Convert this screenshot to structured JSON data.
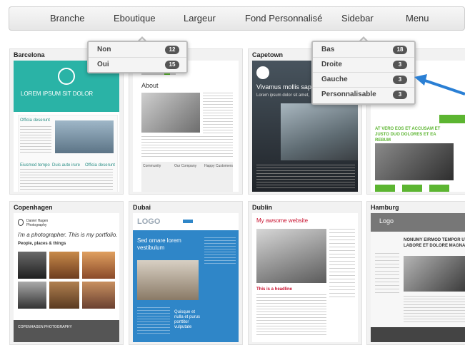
{
  "nav": {
    "items": [
      "Branche",
      "Eboutique",
      "Largeur",
      "Fond Personnalisé",
      "Sidebar",
      "Menu"
    ]
  },
  "dropdown_largeur": {
    "options": [
      {
        "label": "Non",
        "count": "12"
      },
      {
        "label": "Oui",
        "count": "15"
      }
    ]
  },
  "dropdown_sidebar": {
    "options": [
      {
        "label": "Bas",
        "count": "18"
      },
      {
        "label": "Droite",
        "count": "3"
      },
      {
        "label": "Gauche",
        "count": "3"
      },
      {
        "label": "Personnalisable",
        "count": "3"
      }
    ]
  },
  "themes": [
    {
      "name": "Barcelona",
      "texts": {
        "headline": "LOREM IPSUM SIT DOLOR",
        "s1": "Officia deserunt",
        "s2": "Eiusmod tempo",
        "s3": "Duis aute irure",
        "s4": "Officia deserunt"
      }
    },
    {
      "name": "",
      "texts": {
        "heading": "About",
        "c1": "Community",
        "c2": "Our Company",
        "c3": "Happy Customers"
      }
    },
    {
      "name": "Capetown",
      "texts": {
        "headline": "Vivamus mollis sap",
        "sub": "Lorem ipsum dolor sit amet,"
      }
    },
    {
      "name": "",
      "texts": {
        "headline": "AT VERO EOS ET ACCUSAM ET JUSTO DUO DOLORES ET EA REBUM"
      }
    },
    {
      "name": "Copenhagen",
      "texts": {
        "brand": "Daniel Hagen Photography",
        "tagline": "i'm a photographer. This is my portfolio.",
        "section": "People, places & things",
        "footer": "COPENHAGEN PHOTOGRAPHY"
      }
    },
    {
      "name": "Dubai",
      "texts": {
        "logo": "LOGO",
        "headline": "Sed ornare lorem vestibulum",
        "side": "Quisque et nulla et purus porttitor vulputate"
      }
    },
    {
      "name": "Dublin",
      "texts": {
        "title": "My awsome website",
        "headline": "This is a headline"
      }
    },
    {
      "name": "Hamburg",
      "texts": {
        "logo": "Logo",
        "headline": "NONUMY EIRMOD TEMPOR UT LABORE ET DOLORE MAGNA"
      }
    }
  ],
  "colors": {
    "accent_arrow": "#2a7fd4",
    "badge": "#555555",
    "barcelona_teal": "#2ab3a6",
    "dubai_blue": "#2f86c8",
    "copenhagen_footer": "#555555",
    "green_accent": "#5cb531",
    "dublin_red": "#c8102e"
  }
}
